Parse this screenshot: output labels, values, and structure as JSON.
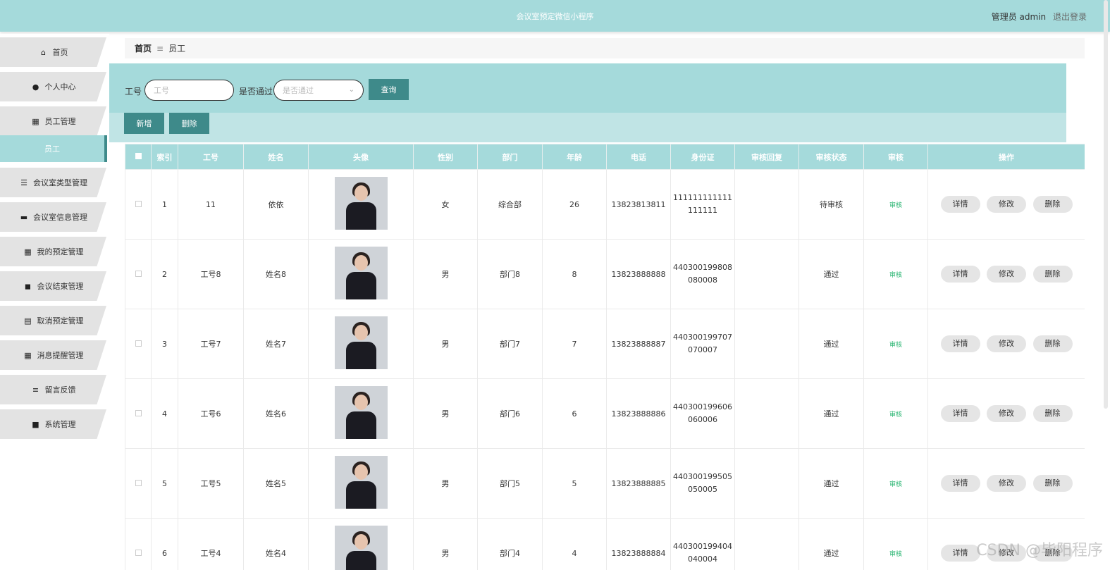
{
  "header": {
    "title": "会议室预定微信小程序",
    "user_label": "管理员 admin",
    "logout": "退出登录"
  },
  "sidebar": {
    "items": [
      {
        "label": "首页",
        "icon": "home-icon",
        "glyph": "⌂"
      },
      {
        "label": "个人中心",
        "icon": "user-icon",
        "glyph": "●"
      },
      {
        "label": "员工管理",
        "icon": "grid-icon",
        "glyph": "▦"
      },
      {
        "label": "员工",
        "icon": "",
        "glyph": ""
      },
      {
        "label": "会议室类型管理",
        "icon": "list-icon",
        "glyph": "☰"
      },
      {
        "label": "会议室信息管理",
        "icon": "monitor-icon",
        "glyph": "▬"
      },
      {
        "label": "我的预定管理",
        "icon": "grid-icon",
        "glyph": "▦"
      },
      {
        "label": "会议结束管理",
        "icon": "camera-icon",
        "glyph": "◼"
      },
      {
        "label": "取消预定管理",
        "icon": "clipboard-icon",
        "glyph": "▤"
      },
      {
        "label": "消息提醒管理",
        "icon": "grid-icon",
        "glyph": "▦"
      },
      {
        "label": "留言反馈",
        "icon": "list-icon",
        "glyph": "≡"
      },
      {
        "label": "系统管理",
        "icon": "briefcase-icon",
        "glyph": "■"
      }
    ]
  },
  "breadcrumb": {
    "home": "首页",
    "sep": "≡",
    "current": "员工"
  },
  "search": {
    "id_label": "工号",
    "id_placeholder": "工号",
    "pass_label": "是否通过",
    "pass_placeholder": "是否通过",
    "query_button": "查询"
  },
  "actions": {
    "add": "新增",
    "delete": "删除"
  },
  "table": {
    "headers": [
      "",
      "索引",
      "工号",
      "姓名",
      "头像",
      "性别",
      "部门",
      "年龄",
      "电话",
      "身份证",
      "审核回复",
      "审核状态",
      "审核",
      "操作"
    ],
    "rows": [
      {
        "index": "1",
        "id": "11",
        "name": "依依",
        "gender": "女",
        "dept": "综合部",
        "age": "26",
        "phone": "13823813811",
        "idcard1": "111111111111",
        "idcard2": "111111",
        "reply": "",
        "status": "待审核",
        "audit": "审核"
      },
      {
        "index": "2",
        "id": "工号8",
        "name": "姓名8",
        "gender": "男",
        "dept": "部门8",
        "age": "8",
        "phone": "13823888888",
        "idcard1": "440300199808",
        "idcard2": "080008",
        "reply": "",
        "status": "通过",
        "audit": "审核"
      },
      {
        "index": "3",
        "id": "工号7",
        "name": "姓名7",
        "gender": "男",
        "dept": "部门7",
        "age": "7",
        "phone": "13823888887",
        "idcard1": "440300199707",
        "idcard2": "070007",
        "reply": "",
        "status": "通过",
        "audit": "审核"
      },
      {
        "index": "4",
        "id": "工号6",
        "name": "姓名6",
        "gender": "男",
        "dept": "部门6",
        "age": "6",
        "phone": "13823888886",
        "idcard1": "440300199606",
        "idcard2": "060006",
        "reply": "",
        "status": "通过",
        "audit": "审核"
      },
      {
        "index": "5",
        "id": "工号5",
        "name": "姓名5",
        "gender": "男",
        "dept": "部门5",
        "age": "5",
        "phone": "13823888885",
        "idcard1": "440300199505",
        "idcard2": "050005",
        "reply": "",
        "status": "通过",
        "audit": "审核"
      },
      {
        "index": "6",
        "id": "工号4",
        "name": "姓名4",
        "gender": "男",
        "dept": "部门4",
        "age": "4",
        "phone": "13823888884",
        "idcard1": "440300199404",
        "idcard2": "040004",
        "reply": "",
        "status": "通过",
        "audit": "审核"
      }
    ],
    "row_actions": {
      "detail": "详情",
      "edit": "修改",
      "delete": "删除"
    }
  },
  "watermark": "CSDN @毕阳程序",
  "colors": {
    "teal": "#a5dadb",
    "teal_dark": "#3e8a8a",
    "audit_green": "#2bb673"
  }
}
